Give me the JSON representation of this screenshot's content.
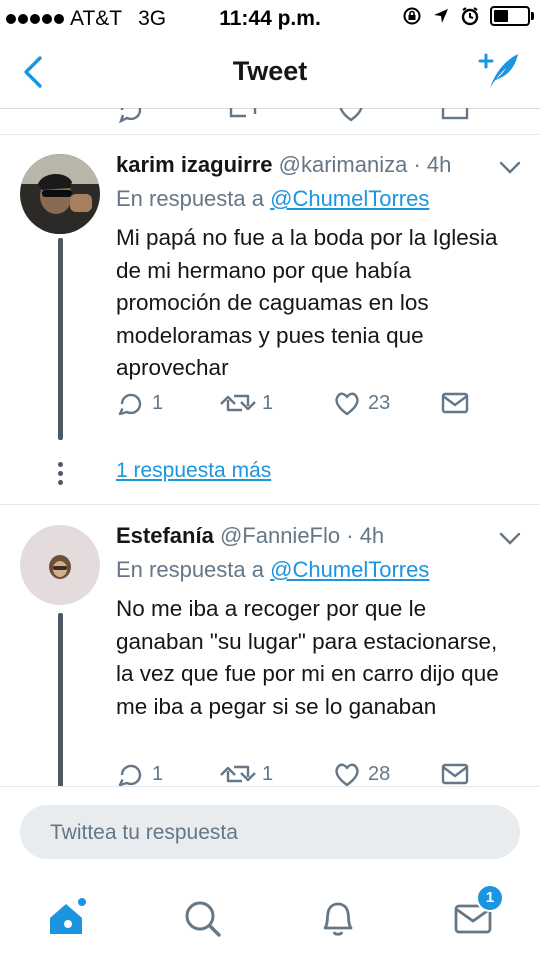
{
  "status_bar": {
    "carrier": "AT&T",
    "network": "3G",
    "time": "11:44 p.m."
  },
  "nav": {
    "title": "Tweet"
  },
  "tweets": [
    {
      "name": "karim izaguirre",
      "handle": "@karimaniza",
      "time": "· 4h",
      "reply_prefix": "En respuesta a",
      "reply_to": "@ChumelTorres",
      "text": "Mi papá no fue a la boda por la Iglesia de mi hermano  por que había promoción de caguamas en los modeloramas y pues tenia que aprovechar",
      "replies": "1",
      "retweets": "1",
      "likes": "23",
      "more_replies": "1 respuesta más"
    },
    {
      "name": "Estefanía",
      "handle": "@FannieFlo",
      "time": "· 4h",
      "reply_prefix": "En respuesta a",
      "reply_to": "@ChumelTorres",
      "text": "No me iba a recoger por que le ganaban \"su lugar\" para estacionarse, la vez que fue por mi en carro dijo que me iba a pegar si se lo ganaban",
      "replies": "1",
      "retweets": "1",
      "likes": "28"
    }
  ],
  "reply_bar": {
    "placeholder": "Twittea tu respuesta"
  },
  "tabs": {
    "home": "home-icon",
    "search": "search-icon",
    "notifications": "bell-icon",
    "messages": "mail-icon",
    "messages_badge": "1"
  },
  "colors": {
    "accent": "#1b95e0",
    "muted": "#657786",
    "text": "#14171a"
  }
}
